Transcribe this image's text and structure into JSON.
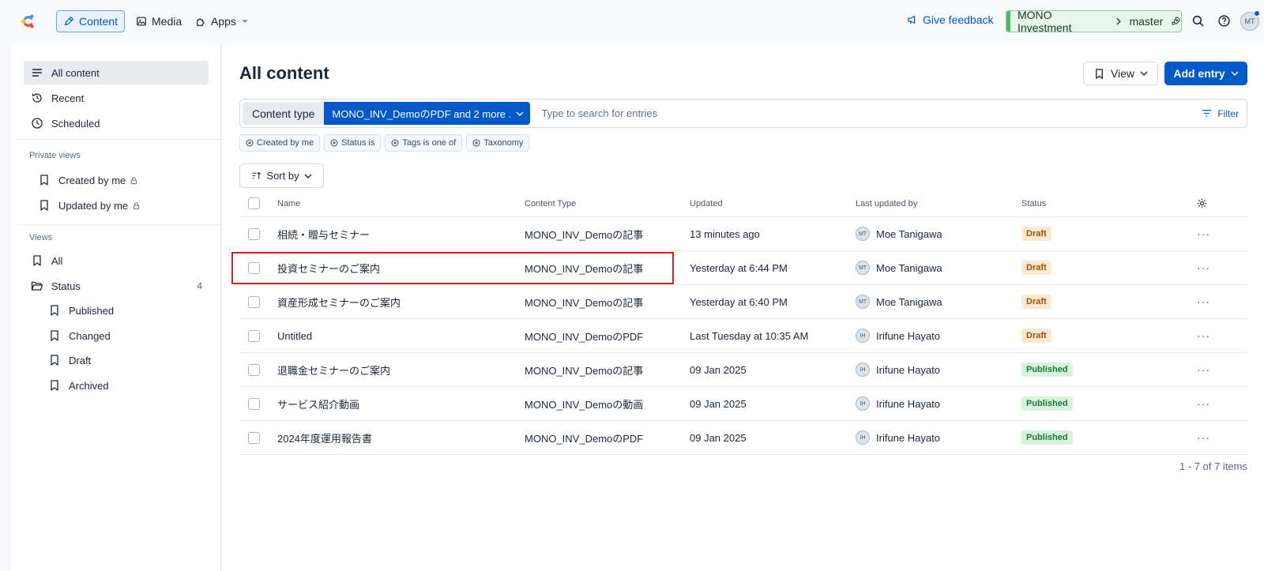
{
  "nav": {
    "content": "Content",
    "media": "Media",
    "apps": "Apps",
    "feedback": "Give feedback",
    "space": "MONO Investment",
    "environment": "master",
    "user_initials": "MT"
  },
  "sidebar": {
    "all_content": "All content",
    "recent": "Recent",
    "scheduled": "Scheduled",
    "private_views_heading": "Private views",
    "created_by_me": "Created by me",
    "updated_by_me": "Updated by me",
    "views_heading": "Views",
    "all": "All",
    "status": "Status",
    "status_count": "4",
    "published": "Published",
    "changed": "Changed",
    "draft": "Draft",
    "archived": "Archived"
  },
  "main": {
    "title": "All content",
    "view_label": "View",
    "add_entry_label": "Add entry",
    "content_type_label": "Content type",
    "content_type_value": "MONO_INV_DemoのPDF and 2 more .",
    "search_placeholder": "Type to search for entries",
    "filter_label": "Filter",
    "chips": [
      "Created by me",
      "Status is",
      "Tags is one of",
      "Taxonomy"
    ],
    "sort_label": "Sort by",
    "columns": {
      "name": "Name",
      "content_type": "Content Type",
      "updated": "Updated",
      "last_updated_by": "Last updated by",
      "status": "Status"
    },
    "rows": [
      {
        "name": "相続・贈与セミナー",
        "type": "MONO_INV_Demoの記事",
        "updated": "13 minutes ago",
        "initials": "MT",
        "by": "Moe Tanigawa",
        "status": "Draft"
      },
      {
        "name": "投資セミナーのご案内",
        "type": "MONO_INV_Demoの記事",
        "updated": "Yesterday at 6:44 PM",
        "initials": "MT",
        "by": "Moe Tanigawa",
        "status": "Draft"
      },
      {
        "name": "資産形成セミナーのご案内",
        "type": "MONO_INV_Demoの記事",
        "updated": "Yesterday at 6:40 PM",
        "initials": "MT",
        "by": "Moe Tanigawa",
        "status": "Draft"
      },
      {
        "name": "Untitled",
        "type": "MONO_INV_DemoのPDF",
        "updated": "Last Tuesday at 10:35 AM",
        "initials": "IH",
        "by": "Irifune Hayato",
        "status": "Draft"
      },
      {
        "name": "退職金セミナーのご案内",
        "type": "MONO_INV_Demoの記事",
        "updated": "09 Jan 2025",
        "initials": "IH",
        "by": "Irifune Hayato",
        "status": "Published"
      },
      {
        "name": "サービス紹介動画",
        "type": "MONO_INV_Demoの動画",
        "updated": "09 Jan 2025",
        "initials": "IH",
        "by": "Irifune Hayato",
        "status": "Published"
      },
      {
        "name": "2024年度運用報告書",
        "type": "MONO_INV_DemoのPDF",
        "updated": "09 Jan 2025",
        "initials": "IH",
        "by": "Irifune Hayato",
        "status": "Published"
      }
    ],
    "more_glyph": "···",
    "pagination": "1 - 7 of 7 items"
  },
  "colors": {
    "accent": "#0059c8",
    "draft_bg": "#fce9d3",
    "published_bg": "#d7f3dc",
    "highlight": "#e01f1f"
  }
}
